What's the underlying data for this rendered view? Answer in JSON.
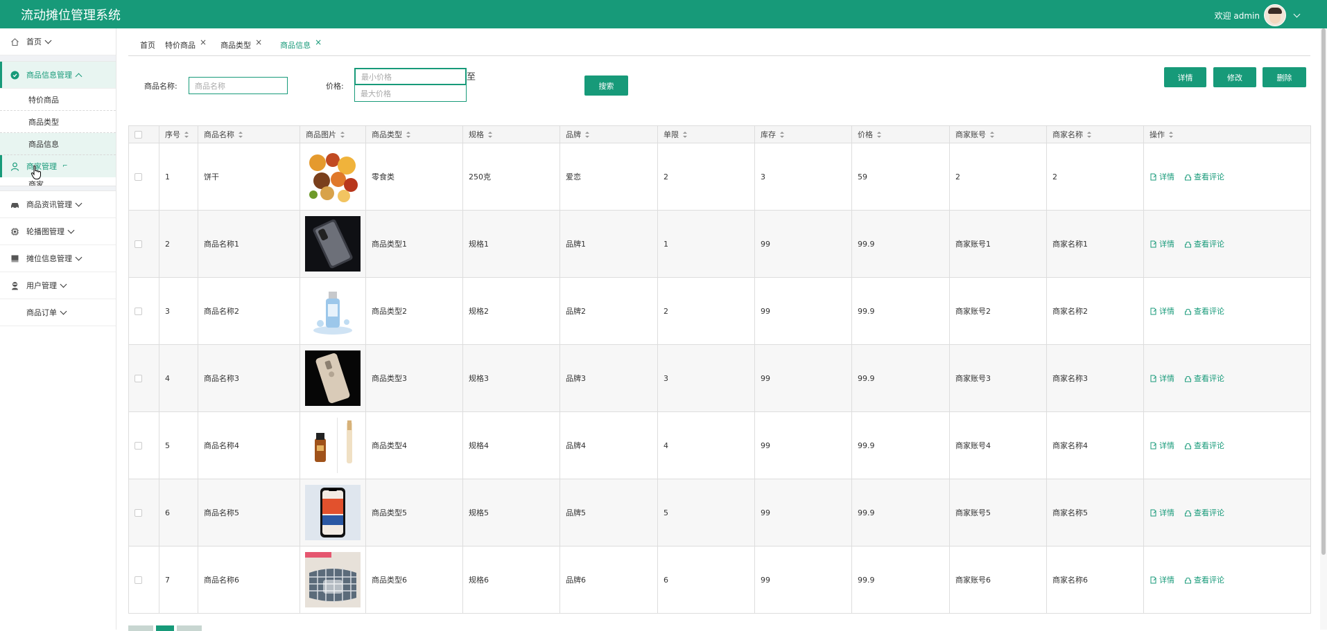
{
  "header": {
    "title": "流动摊位管理系统",
    "welcome": "欢迎 admin"
  },
  "sidebar": {
    "items": [
      {
        "label": "首页",
        "icon": "home-icon"
      },
      {
        "label": "商品信息管理",
        "icon": "check-circle-icon"
      },
      {
        "label": "商家管理",
        "icon": "user-icon"
      },
      {
        "label": "商品资讯管理",
        "icon": "car-icon"
      },
      {
        "label": "轮播图管理",
        "icon": "chip-icon"
      },
      {
        "label": "摊位信息管理",
        "icon": "stall-icon"
      },
      {
        "label": "用户管理",
        "icon": "person-icon"
      },
      {
        "label": "商品订单",
        "icon": ""
      }
    ],
    "sub_items": [
      "特价商品",
      "商品类型",
      "商品信息"
    ],
    "partial_sub": "商家"
  },
  "tabs": [
    {
      "label": "首页",
      "closable": false
    },
    {
      "label": "特价商品",
      "closable": true
    },
    {
      "label": "商品类型",
      "closable": true
    },
    {
      "label": "商品信息",
      "closable": true
    }
  ],
  "search": {
    "name_label": "商品名称:",
    "name_placeholder": "商品名称",
    "price_label": "价格:",
    "min_placeholder": "最小价格",
    "max_placeholder": "最大价格",
    "to": "至",
    "search_btn": "搜索"
  },
  "actions": {
    "detail": "详情",
    "edit": "修改",
    "delete": "删除"
  },
  "table": {
    "headers": [
      "序号",
      "商品名称",
      "商品图片",
      "商品类型",
      "规格",
      "品牌",
      "单限",
      "库存",
      "价格",
      "商家账号",
      "商家名称",
      "操作"
    ],
    "op_detail": "详情",
    "op_comment": "查看评论",
    "rows": [
      {
        "no": "1",
        "name": "饼干",
        "img": "snacks",
        "type": "零食类",
        "spec": "250克",
        "brand": "爱恋",
        "limit": "2",
        "stock": "3",
        "price": "59",
        "account": "2",
        "merchant": "2"
      },
      {
        "no": "2",
        "name": "商品名称1",
        "img": "phone-dark",
        "type": "商品类型1",
        "spec": "规格1",
        "brand": "品牌1",
        "limit": "1",
        "stock": "99",
        "price": "99.9",
        "account": "商家账号1",
        "merchant": "商家名称1"
      },
      {
        "no": "3",
        "name": "商品名称2",
        "img": "bottle",
        "type": "商品类型2",
        "spec": "规格2",
        "brand": "品牌2",
        "limit": "2",
        "stock": "99",
        "price": "99.9",
        "account": "商家账号2",
        "merchant": "商家名称2"
      },
      {
        "no": "4",
        "name": "商品名称3",
        "img": "phone-gold",
        "type": "商品类型3",
        "spec": "规格3",
        "brand": "品牌3",
        "limit": "3",
        "stock": "99",
        "price": "99.9",
        "account": "商家账号3",
        "merchant": "商家名称3"
      },
      {
        "no": "5",
        "name": "商品名称4",
        "img": "cosmetics",
        "type": "商品类型4",
        "spec": "规格4",
        "brand": "品牌4",
        "limit": "4",
        "stock": "99",
        "price": "99.9",
        "account": "商家账号4",
        "merchant": "商家名称4"
      },
      {
        "no": "6",
        "name": "商品名称5",
        "img": "smartphone",
        "type": "商品类型5",
        "spec": "规格5",
        "brand": "品牌5",
        "limit": "5",
        "stock": "99",
        "price": "99.9",
        "account": "商家账号5",
        "merchant": "商家名称5"
      },
      {
        "no": "7",
        "name": "商品名称6",
        "img": "cushion",
        "type": "商品类型6",
        "spec": "规格6",
        "brand": "品牌6",
        "limit": "6",
        "stock": "99",
        "price": "99.9",
        "account": "商家账号6",
        "merchant": "商家名称6"
      }
    ]
  },
  "colors": {
    "brand": "#179a79"
  }
}
